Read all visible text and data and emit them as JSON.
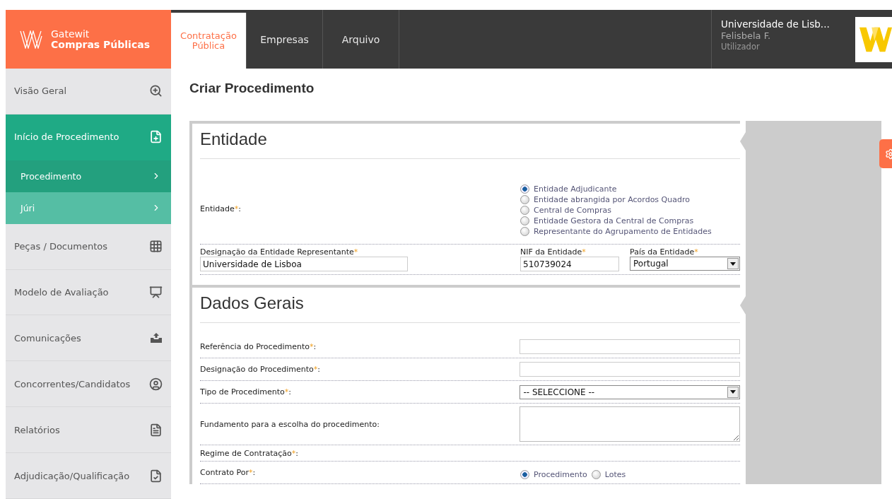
{
  "header": {
    "brand": [
      "Gatewit",
      "Compras Públicas"
    ],
    "tabs": [
      {
        "label": [
          "Contratação",
          "Pública"
        ],
        "selected": true
      },
      {
        "label": [
          "Empresas"
        ],
        "selected": false
      },
      {
        "label": [
          "Arquivo"
        ],
        "selected": false
      }
    ],
    "user": {
      "organisation": "Universidade de Lisb...",
      "name": "Felisbela F.",
      "role": "Utilizador"
    }
  },
  "sidebar": {
    "items": [
      {
        "label": "Visão Geral",
        "selected": false
      },
      {
        "label": "Início de Procedimento",
        "selected": true,
        "children": [
          {
            "label": "Procedimento",
            "selected": true
          },
          {
            "label": "Júri",
            "selected": false
          }
        ]
      },
      {
        "label": "Peças / Documentos",
        "selected": false
      },
      {
        "label": "Modelo de Avaliação",
        "selected": false
      },
      {
        "label": "Comunicações",
        "selected": false
      },
      {
        "label": "Concorrentes/Candidatos",
        "selected": false
      },
      {
        "label": "Relatórios",
        "selected": false
      },
      {
        "label": "Adjudicação/Qualificação",
        "selected": false
      }
    ]
  },
  "page_title": "Criar Procedimento",
  "entidade": {
    "title": "Entidade",
    "label": {
      "text": "Entidade",
      "required": "*",
      "suffix": ":"
    },
    "options": [
      {
        "label": "Entidade Adjudicante",
        "selected": true
      },
      {
        "label": "Entidade abrangida por Acordos Quadro",
        "selected": false
      },
      {
        "label": "Central de Compras",
        "selected": false
      },
      {
        "label": "Entidade Gestora da Central de Compras",
        "selected": false
      },
      {
        "label": "Representante do Agrupamento de Entidades",
        "selected": false
      }
    ],
    "fields": [
      {
        "kind": "text",
        "label": {
          "text": "Designação da Entidade Representante",
          "required": "*"
        },
        "value": "Universidade de Lisboa"
      },
      {
        "kind": "text",
        "label": {
          "text": "NIF da Entidade",
          "required": "*"
        },
        "value": "510739024"
      },
      {
        "kind": "select",
        "label": {
          "text": "País da Entidade",
          "required": "*"
        },
        "value": "Portugal"
      }
    ]
  },
  "dados_gerais": {
    "title": "Dados Gerais",
    "rows": [
      {
        "kind": "text",
        "label": {
          "text": "Referência do Procedimento",
          "required": "*",
          "suffix": ":"
        }
      },
      {
        "kind": "text",
        "label": {
          "text": "Designação do Procedimento",
          "required": "*",
          "suffix": ":"
        }
      },
      {
        "kind": "select",
        "label": {
          "text": "Tipo de Procedimento",
          "required": "*",
          "suffix": ":"
        },
        "value": "-- SELECCIONE --"
      },
      {
        "kind": "textarea",
        "label": {
          "text": "Fundamento para a escolha do procedimento:"
        }
      },
      {
        "kind": "heading",
        "label": {
          "text": "Regime de Contratação",
          "required": "*",
          "suffix": ":"
        }
      },
      {
        "kind": "radio",
        "label": {
          "text": "Contrato Por",
          "required": "*",
          "suffix": ":"
        },
        "options": [
          {
            "label": "Procedimento",
            "selected": true
          },
          {
            "label": "Lotes",
            "selected": false
          }
        ]
      }
    ]
  }
}
